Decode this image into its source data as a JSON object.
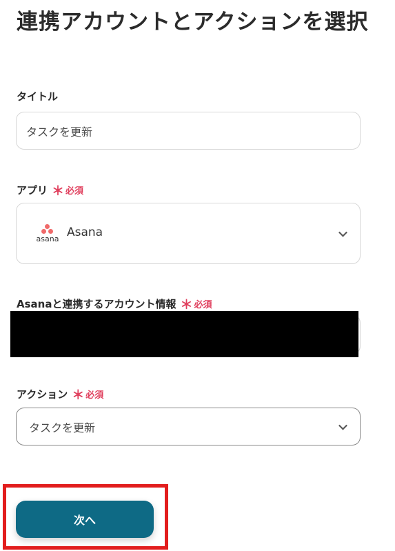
{
  "page_title": "連携アカウントとアクションを選択",
  "required_mark": "＊",
  "required_text": "必須",
  "fields": {
    "title": {
      "label": "タイトル",
      "value": "タスクを更新"
    },
    "app": {
      "label": "アプリ",
      "value": "Asana",
      "logo_text": "asana"
    },
    "account": {
      "label": "Asanaと連携するアカウント情報"
    },
    "action": {
      "label": "アクション",
      "value": "タスクを更新"
    }
  },
  "next_button": {
    "label": "次へ"
  },
  "colors": {
    "accent": "#0e6a85",
    "required": "#e0405e",
    "asana": "#f06a6a",
    "highlight": "#e21d1d"
  },
  "icons": {
    "dropdown": "chevron-down-icon",
    "app_logo": "asana-logo-icon"
  }
}
